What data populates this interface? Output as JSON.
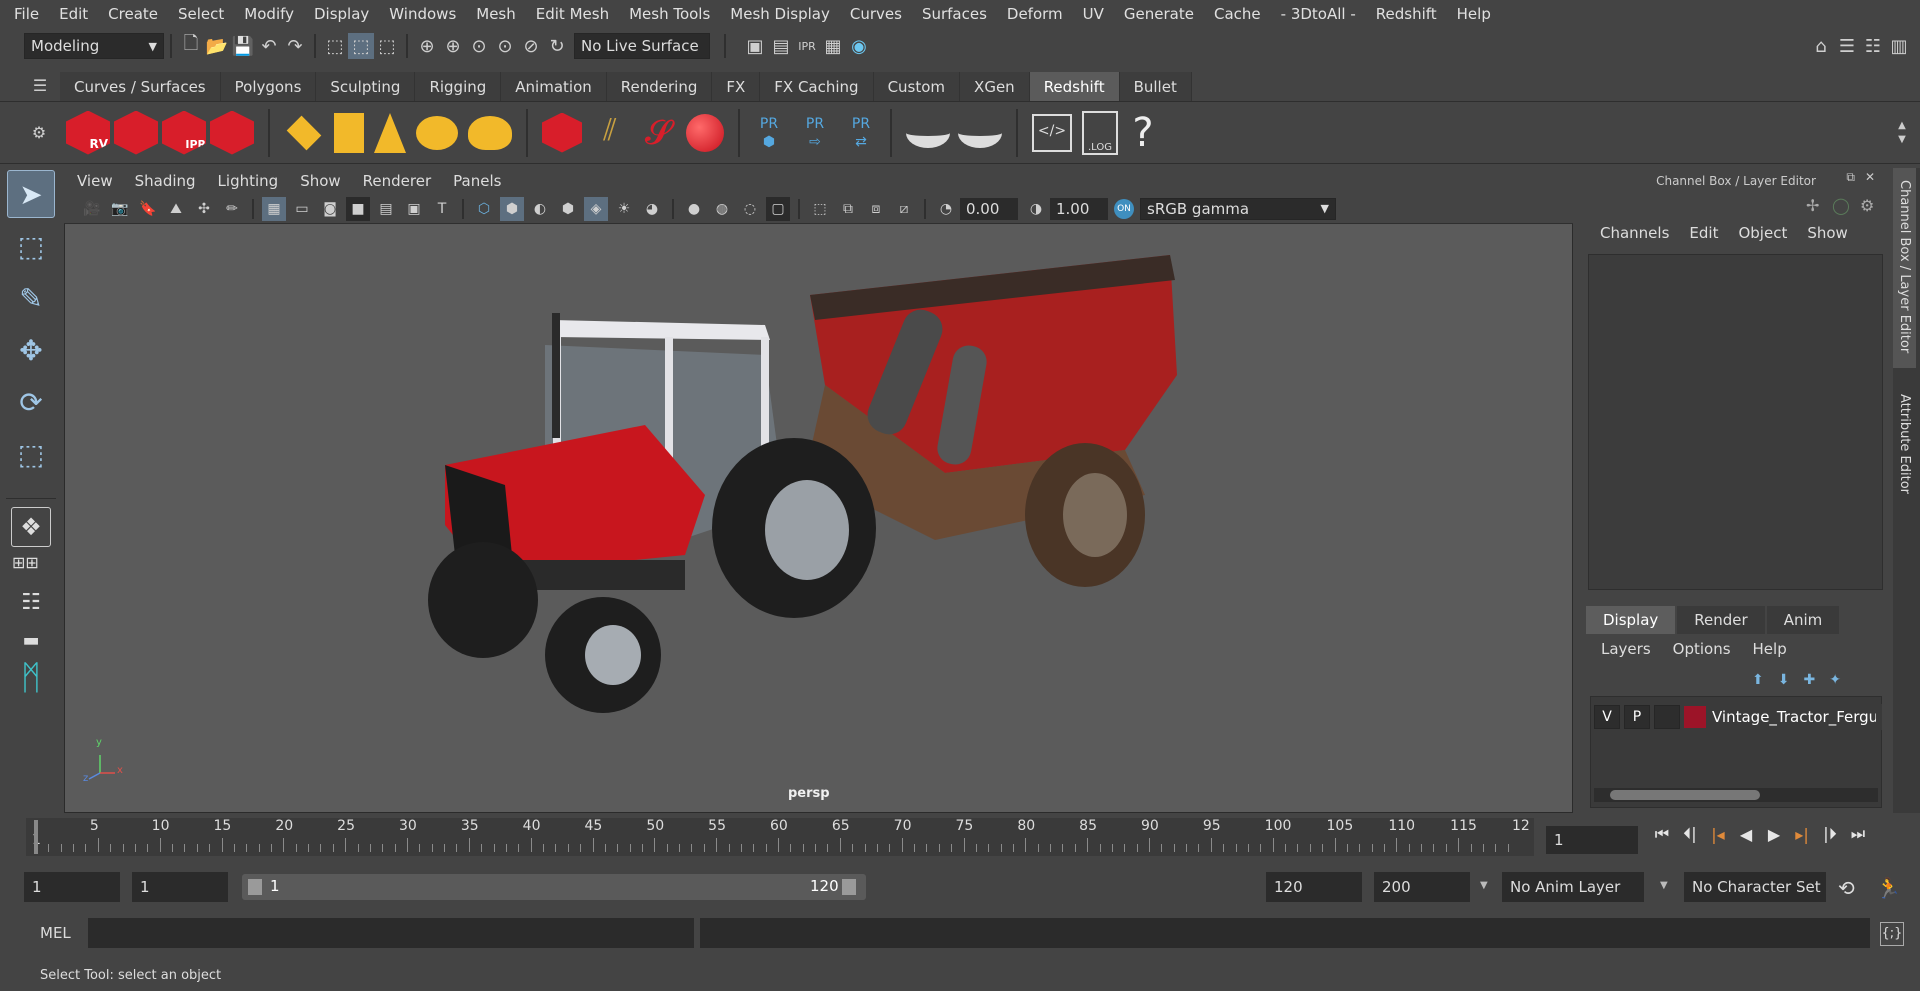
{
  "menubar": {
    "items": [
      "File",
      "Edit",
      "Create",
      "Select",
      "Modify",
      "Display",
      "Windows",
      "Mesh",
      "Edit Mesh",
      "Mesh Tools",
      "Mesh Display",
      "Curves",
      "Surfaces",
      "Deform",
      "UV",
      "Generate",
      "Cache",
      "- 3DtoAll -",
      "Redshift",
      "Help"
    ]
  },
  "statusline": {
    "menuset": "Modeling",
    "live_surface": "No Live Surface"
  },
  "shelf": {
    "tabs": [
      "Curves / Surfaces",
      "Polygons",
      "Sculpting",
      "Rigging",
      "Animation",
      "Rendering",
      "FX",
      "FX Caching",
      "Custom",
      "XGen",
      "Redshift",
      "Bullet"
    ],
    "active_tab": "Redshift",
    "icon_labels": {
      "rv": "RV",
      "ipr": "IPR",
      "pr": "PR",
      "log": ".LOG",
      "help": "?"
    }
  },
  "viewport": {
    "menu": [
      "View",
      "Shading",
      "Lighting",
      "Show",
      "Renderer",
      "Panels"
    ],
    "exposure": "0.00",
    "gamma": "1.00",
    "color_space": "sRGB gamma",
    "camera_label": "persp",
    "axis": {
      "x": "x",
      "y": "y",
      "z": "z"
    }
  },
  "channel_box": {
    "title": "Channel Box / Layer Editor",
    "menu": [
      "Channels",
      "Edit",
      "Object",
      "Show"
    ]
  },
  "layer_editor": {
    "tabs": [
      "Display",
      "Render",
      "Anim"
    ],
    "active_tab": "Display",
    "menu": [
      "Layers",
      "Options",
      "Help"
    ],
    "layer": {
      "v": "V",
      "p": "P",
      "name": "Vintage_Tractor_Fergus",
      "color": "#9c1428"
    }
  },
  "side_tabs": [
    "Channel Box / Layer Editor",
    "Attribute Editor"
  ],
  "timeline": {
    "ticks": [
      "1",
      "5",
      "10",
      "15",
      "20",
      "25",
      "30",
      "35",
      "40",
      "45",
      "50",
      "55",
      "60",
      "65",
      "70",
      "75",
      "80",
      "85",
      "90",
      "95",
      "100",
      "105",
      "110",
      "115",
      "12"
    ],
    "current_frame": "1"
  },
  "range": {
    "start": "1",
    "playback_start": "1",
    "slider_start": "1",
    "slider_end": "120",
    "playback_end": "120",
    "end": "200",
    "anim_layer": "No Anim Layer",
    "character_set": "No Character Set"
  },
  "command": {
    "language": "MEL"
  },
  "help_line": "Select Tool: select an object",
  "colors": {
    "redshift_red": "#d81e2a",
    "accent_blue": "#55a8e0",
    "shelf_yellow": "#f2b92a"
  }
}
